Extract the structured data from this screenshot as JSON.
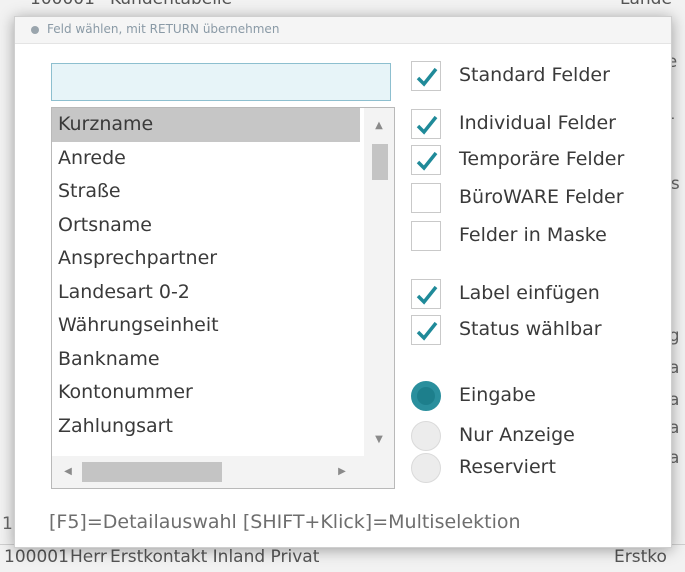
{
  "background": {
    "top_row": [
      "100001",
      "Kundentabelle",
      "Lahde"
    ],
    "bottom_row": [
      "100001",
      "Herr",
      "Erstkontakt Inland Privat",
      "Erstko"
    ],
    "left_fragment": "1",
    "right_fragments": [
      "d",
      "le",
      "n",
      "ir",
      "n",
      "ss",
      "a",
      "e",
      "rg",
      "ra",
      "ra",
      "ra",
      "ra",
      "o"
    ]
  },
  "dialog": {
    "title": "Feld wählen, mit RETURN übernehmen",
    "search": {
      "value": "",
      "placeholder": ""
    },
    "list": {
      "items": [
        "Kurzname",
        "Anrede",
        "Straße",
        "Ortsname",
        "Ansprechpartner",
        "Landesart 0-2",
        "Währungseinheit",
        "Bankname",
        "Kontonummer",
        "Zahlungsart"
      ],
      "selected": "Kurzname"
    },
    "field_options": [
      {
        "label": "Standard Felder",
        "checked": true
      },
      {
        "label": "Individual Felder",
        "checked": true
      },
      {
        "label": "Temporäre Felder",
        "checked": true
      },
      {
        "label": "BüroWARE Felder",
        "checked": false
      },
      {
        "label": "Felder in Maske",
        "checked": false
      }
    ],
    "extra_options": [
      {
        "label": "Label einfügen",
        "checked": true
      },
      {
        "label": "Status wählbar",
        "checked": true
      }
    ],
    "modes": [
      {
        "label": "Eingabe",
        "selected": true
      },
      {
        "label": "Nur Anzeige",
        "selected": false
      },
      {
        "label": "Reserviert",
        "selected": false
      }
    ],
    "footer": "[F5]=Detailauswahl [SHIFT+Klick]=Multiselektion"
  },
  "colors": {
    "accent": "#2a8f9d",
    "check": "#1f8a99",
    "selected_row": "#c6c6c6",
    "input_bg": "#e7f4f8"
  },
  "icons": {
    "check": "check-icon",
    "scroll_up": "arrow-up-icon",
    "scroll_down": "arrow-down-icon",
    "scroll_left": "arrow-left-icon",
    "scroll_right": "arrow-right-icon"
  }
}
